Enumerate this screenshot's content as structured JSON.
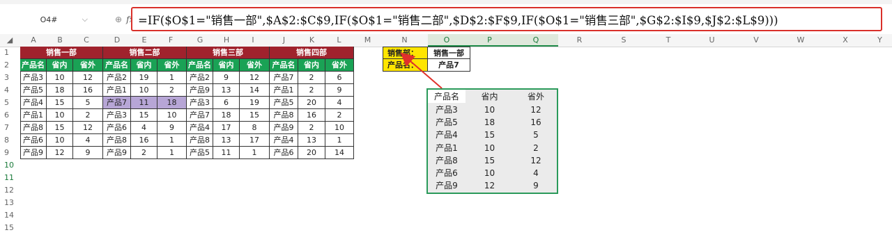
{
  "namebox": {
    "cell": "O4#"
  },
  "formula": "=IF($O$1=\"销售一部\",$A$2:$C$9,IF($O$1=\"销售二部\",$D$2:$F$9,IF($O$1=\"销售三部\",$G$2:$I$9,$J$2:$L$9)))",
  "columns": [
    "A",
    "B",
    "C",
    "D",
    "E",
    "F",
    "G",
    "H",
    "I",
    "J",
    "K",
    "L",
    "M",
    "N",
    "O",
    "P",
    "Q",
    "R",
    "S",
    "T",
    "U",
    "V",
    "W",
    "X",
    "Y"
  ],
  "rows": [
    "1",
    "2",
    "3",
    "4",
    "5",
    "6",
    "7",
    "8",
    "9",
    "10",
    "11",
    "12",
    "13",
    "14",
    "15"
  ],
  "departments": [
    "销售一部",
    "销售二部",
    "销售三部",
    "销售四部"
  ],
  "subheaders": [
    "产品名",
    "省内",
    "省外"
  ],
  "tables": [
    [
      [
        "产品3",
        "10",
        "12"
      ],
      [
        "产品5",
        "18",
        "16"
      ],
      [
        "产品4",
        "15",
        "5"
      ],
      [
        "产品1",
        "10",
        "2"
      ],
      [
        "产品8",
        "15",
        "12"
      ],
      [
        "产品6",
        "10",
        "4"
      ],
      [
        "产品9",
        "12",
        "9"
      ]
    ],
    [
      [
        "产品2",
        "19",
        "1"
      ],
      [
        "产品1",
        "10",
        "2"
      ],
      [
        "产品7",
        "11",
        "18"
      ],
      [
        "产品3",
        "15",
        "10"
      ],
      [
        "产品6",
        "4",
        "9"
      ],
      [
        "产品8",
        "16",
        "1"
      ],
      [
        "产品9",
        "2",
        "1"
      ]
    ],
    [
      [
        "产品2",
        "9",
        "12"
      ],
      [
        "产品9",
        "13",
        "14"
      ],
      [
        "产品3",
        "6",
        "19"
      ],
      [
        "产品7",
        "18",
        "15"
      ],
      [
        "产品4",
        "17",
        "8"
      ],
      [
        "产品8",
        "13",
        "17"
      ],
      [
        "产品5",
        "11",
        "1"
      ]
    ],
    [
      [
        "产品7",
        "2",
        "6"
      ],
      [
        "产品1",
        "2",
        "9"
      ],
      [
        "产品5",
        "20",
        "4"
      ],
      [
        "产品8",
        "16",
        "2"
      ],
      [
        "产品9",
        "2",
        "10"
      ],
      [
        "产品4",
        "13",
        "1"
      ],
      [
        "产品6",
        "20",
        "14"
      ]
    ]
  ],
  "lookup": {
    "dept_label": "销售部：",
    "dept_value": "销售一部",
    "product_label": "产品名：",
    "product_value": "产品7"
  },
  "result": {
    "headers": [
      "产品名",
      "省内",
      "省外"
    ],
    "rows": [
      [
        "产品3",
        "10",
        "12"
      ],
      [
        "产品5",
        "18",
        "16"
      ],
      [
        "产品4",
        "15",
        "5"
      ],
      [
        "产品1",
        "10",
        "2"
      ],
      [
        "产品8",
        "15",
        "12"
      ],
      [
        "产品6",
        "10",
        "4"
      ],
      [
        "产品9",
        "12",
        "9"
      ]
    ]
  },
  "colors": {
    "dept_header": "#a0222d",
    "sub_header": "#1aa255",
    "highlight": "#b7a6d6",
    "lookup_bg": "#ffe500",
    "formula_border": "#d9302a",
    "result_border": "#2a9a5a"
  }
}
